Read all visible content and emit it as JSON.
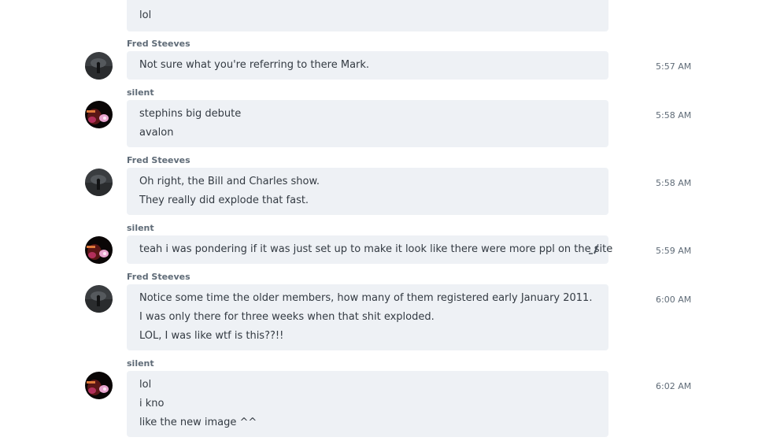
{
  "top_message": {
    "faded_text": "...",
    "line": "lol"
  },
  "messages": [
    {
      "sender": "Fred Steeves",
      "time": "5:57 AM",
      "avatar": "fred-avatar",
      "lines": [
        "Not sure what you're referring to there Mark."
      ]
    },
    {
      "sender": "silent",
      "time": "5:58 AM",
      "avatar": "silent-avatar",
      "lines": [
        "stephins big debute",
        "avalon"
      ]
    },
    {
      "sender": "Fred Steeves",
      "time": "5:58 AM",
      "avatar": "fred-avatar",
      "lines": [
        "Oh right, the Bill and Charles show.",
        "They really did explode that fast."
      ]
    },
    {
      "sender": "silent",
      "time": "5:59 AM",
      "avatar": "silent-avatar",
      "lines": [
        "teah i was pondering if it was just set up to make it look like there  were more ppl on the site"
      ],
      "has_edit_icon": true
    },
    {
      "sender": "Fred Steeves",
      "time": "6:00 AM",
      "avatar": "fred-avatar",
      "lines": [
        "Notice some time the older members, how many of them registered early January 2011.",
        "I was only there for three weeks when that shit exploded.",
        "LOL, I was like wtf is this??!!"
      ]
    },
    {
      "sender": "silent",
      "time": "6:02 AM",
      "avatar": "silent-avatar",
      "lines": [
        "lol",
        "i kno",
        "like the new image ^^"
      ]
    }
  ],
  "colors": {
    "bubble_bg": "#eef1f5",
    "sender_text": "#5f6b77",
    "message_text": "#333a42",
    "timestamp_text": "#5f6b77"
  }
}
